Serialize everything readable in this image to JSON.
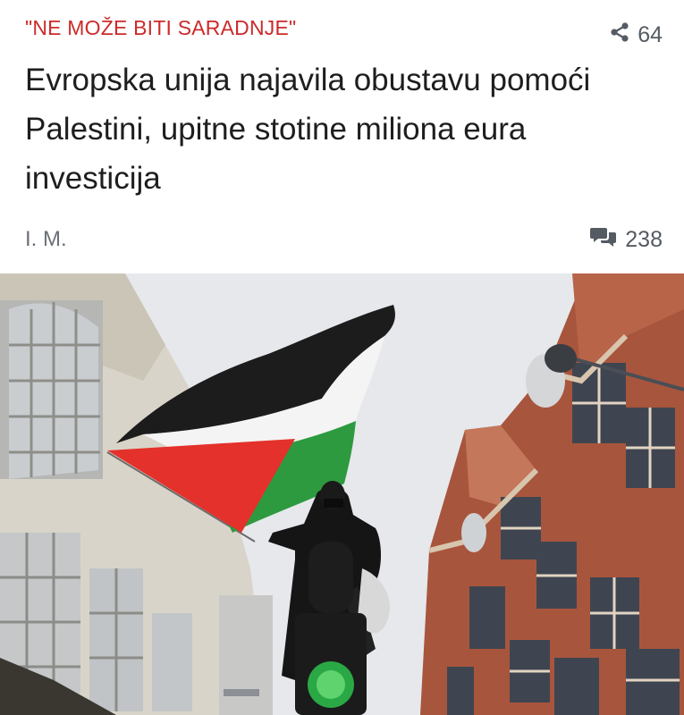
{
  "article": {
    "kicker": "\"NE MOŽE BITI SARADNJE\"",
    "share_count": "64",
    "share_icon": "share-icon",
    "headline": "Evropska unija najavila obustavu pomoći Palestini, upitne stotine miliona eura investicija",
    "author": "I. M.",
    "comment_count": "238",
    "comment_icon": "comments-icon"
  },
  "colors": {
    "kicker": "#cc2b2b",
    "headline": "#1e1e1e",
    "meta": "#555b63",
    "flag_black": "#1c1c1c",
    "flag_white": "#f4f4f4",
    "flag_green": "#2e9a3f",
    "flag_red": "#e4312b"
  }
}
